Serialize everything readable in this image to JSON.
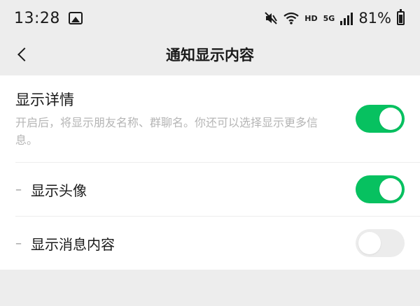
{
  "status_bar": {
    "time": "13:28",
    "network_label": "HD",
    "signal_label": "5G",
    "battery_percent": "81%",
    "icons": [
      "image-icon",
      "mute-icon",
      "wifi-icon",
      "signal-icon",
      "battery-icon"
    ]
  },
  "nav": {
    "title": "通知显示内容"
  },
  "settings": {
    "show_details": {
      "title": "显示详情",
      "description": "开启后，将显示朋友名称、群聊名。你还可以选择显示更多信息。",
      "enabled": true
    },
    "show_avatar": {
      "dash": "–",
      "label": "显示头像",
      "enabled": true
    },
    "show_message_content": {
      "dash": "–",
      "label": "显示消息内容",
      "enabled": false
    }
  },
  "colors": {
    "toggle_on": "#07c160",
    "toggle_off": "#ececec",
    "background": "#ededed",
    "secondary_text": "#b5b5b5"
  }
}
